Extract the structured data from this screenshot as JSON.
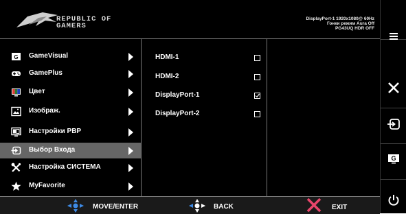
{
  "header": {
    "brand_line1": "REPUBLIC OF",
    "brand_line2": "GAMERS",
    "status_line1": "DisplayPort-1 1920x1080@ 60Hz",
    "status_line2": "Гонки режим Aura Off",
    "status_line3": "PG43UQ HDR OFF"
  },
  "menu": {
    "items": [
      {
        "label": "GameVisual",
        "icon": "gamevisual-icon"
      },
      {
        "label": "GamePlus",
        "icon": "gamepad-icon"
      },
      {
        "label": "Цвет",
        "icon": "color-icon"
      },
      {
        "label": "Изображ.",
        "icon": "image-icon"
      },
      {
        "label": "Настройки PBP",
        "icon": "pbp-icon"
      },
      {
        "label": "Выбор Входа",
        "icon": "input-icon"
      },
      {
        "label": "Настройка СИСТЕМА",
        "icon": "tools-icon"
      },
      {
        "label": "MyFavorite",
        "icon": "star-icon"
      }
    ],
    "active_index": 5
  },
  "submenu": {
    "items": [
      {
        "label": "HDMI-1",
        "checked": false
      },
      {
        "label": "HDMI-2",
        "checked": false
      },
      {
        "label": "DisplayPort-1",
        "checked": true
      },
      {
        "label": "DisplayPort-2",
        "checked": false
      }
    ]
  },
  "footer": {
    "move_label": "MOVE/ENTER",
    "back_label": "BACK",
    "exit_label": "EXIT"
  },
  "colors": {
    "accent_blue": "#3d8ae6",
    "exit_pink": "#e8456b",
    "active_bg": "#666666"
  }
}
